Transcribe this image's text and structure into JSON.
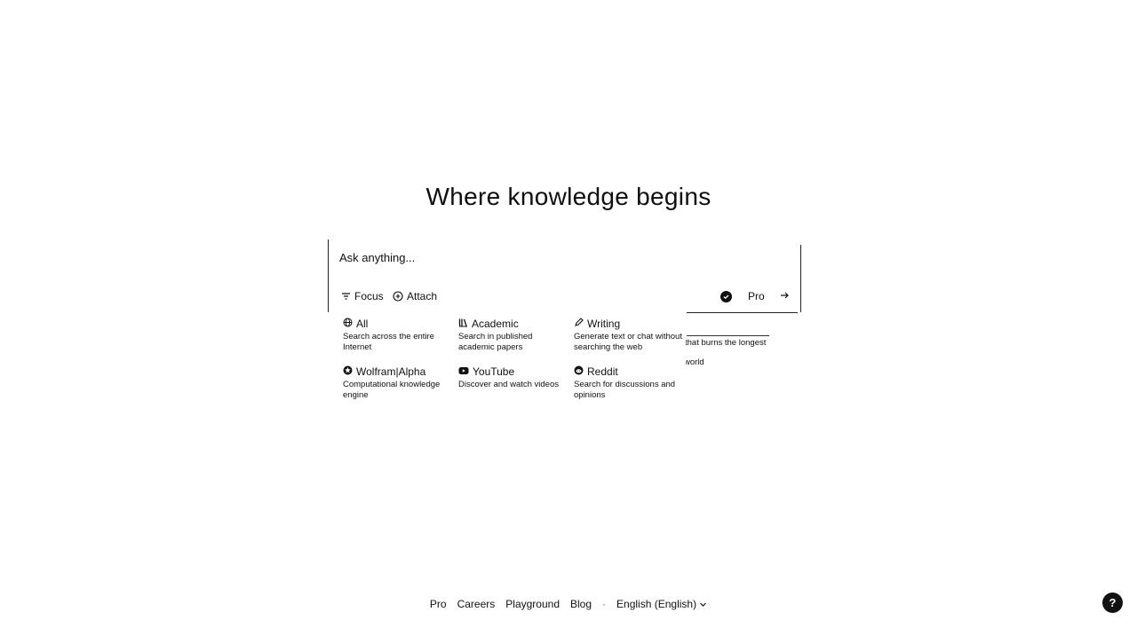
{
  "headline": "Where knowledge begins",
  "search": {
    "placeholder": "Ask anything...",
    "focus_label": "Focus",
    "attach_label": "Attach",
    "pro_label": "Pro",
    "submit_icon": "arrow-right-icon"
  },
  "focus_menu": {
    "items": [
      {
        "label": "All",
        "desc": "Search across the entire Internet",
        "icon": "globe-icon"
      },
      {
        "label": "Academic",
        "desc": "Search in published academic papers",
        "icon": "books-icon"
      },
      {
        "label": "Writing",
        "desc": "Generate text or chat without searching the web",
        "icon": "pen-icon"
      },
      {
        "label": "Wolfram|Alpha",
        "desc": "Computational knowledge engine",
        "icon": "wolfram-icon"
      },
      {
        "label": "YouTube",
        "desc": "Discover and watch videos",
        "icon": "youtube-icon"
      },
      {
        "label": "Reddit",
        "desc": "Search for discussions and opinions",
        "icon": "reddit-icon"
      }
    ]
  },
  "suggestions": [
    {
      "text": "that burns the longest"
    },
    {
      "text": "world"
    }
  ],
  "footer": {
    "links": [
      "Pro",
      "Careers",
      "Playground",
      "Blog"
    ],
    "language": "English (English)"
  },
  "help_label": "?",
  "colors": {
    "text": "#111111",
    "background": "#ffffff"
  }
}
